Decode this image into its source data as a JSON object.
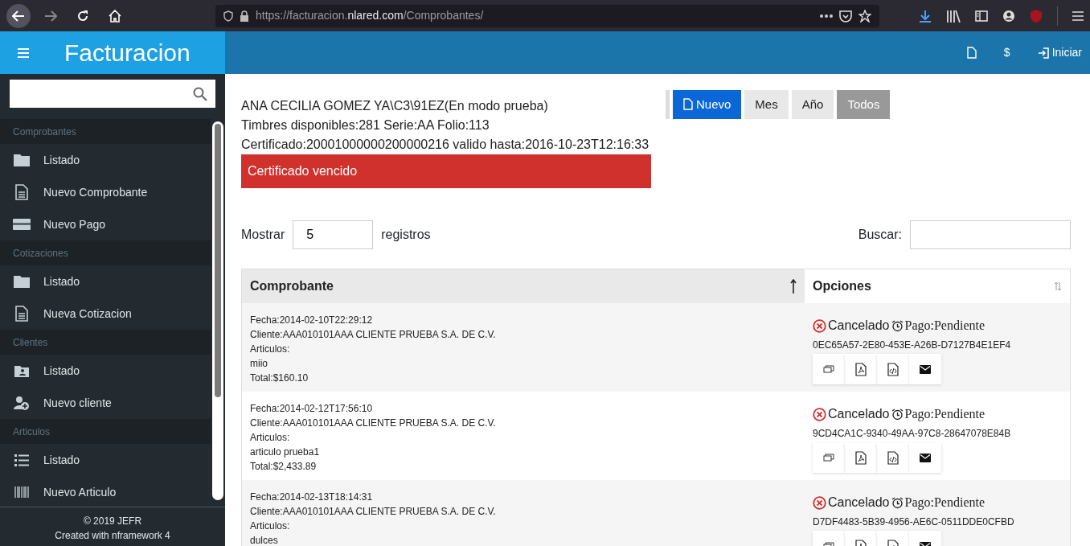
{
  "browser": {
    "url_prefix": "https://facturacion.",
    "url_domain": "nlared.com",
    "url_path": "/Comprobantes/"
  },
  "app_bar": {
    "title": "Facturacion",
    "actions": [
      {
        "kind": "file"
      },
      {
        "kind": "text",
        "label": "$"
      },
      {
        "kind": "login",
        "label": "Iniciar"
      }
    ]
  },
  "sidebar": {
    "sections": [
      {
        "title": "Comprobantes",
        "items": [
          {
            "kind": "folder",
            "label": "Listado"
          },
          {
            "kind": "document",
            "label": "Nuevo Comprobante"
          },
          {
            "kind": "card",
            "label": "Nuevo Pago"
          }
        ]
      },
      {
        "title": "Cotizaciones",
        "items": [
          {
            "kind": "folder",
            "label": "Listado"
          },
          {
            "kind": "document",
            "label": "Nueva Cotizacion"
          }
        ]
      },
      {
        "title": "Clientes",
        "items": [
          {
            "kind": "contact",
            "label": "Listado"
          },
          {
            "kind": "person-add",
            "label": "Nuevo cliente"
          }
        ]
      },
      {
        "title": "Articulos",
        "items": [
          {
            "kind": "list",
            "label": "Listado"
          },
          {
            "kind": "barcode",
            "label": "Nuevo Articulo"
          }
        ]
      }
    ],
    "footer": [
      "© 2019 JEFR",
      "Created with nframework 4"
    ]
  },
  "info": {
    "lines": [
      "ANA CECILIA GOMEZ YA\\C3\\91EZ(En modo prueba)",
      "Timbres disponibles:281 Serie:AA Folio:113",
      "Certificado:20001000000200000216 valido hasta:2016-10-23T12:16:33"
    ],
    "alert": "Certificado vencido"
  },
  "filter_buttons": [
    {
      "kind": "primary",
      "label": "Nuevo",
      "selected": false
    },
    {
      "kind": "filter",
      "label": "Mes",
      "selected": false
    },
    {
      "kind": "filter",
      "label": "Año",
      "selected": false
    },
    {
      "kind": "filter",
      "label": "Todos",
      "selected": true
    }
  ],
  "table_controls": {
    "show_label": "Mostrar",
    "page_size": "5",
    "records_label": "registros",
    "search_label": "Buscar:"
  },
  "table": {
    "columns": [
      {
        "label": "Comprobante",
        "sorted": true
      },
      {
        "label": "Opciones",
        "sorted": false
      }
    ],
    "rows": [
      {
        "lines": [
          "Fecha:2014-02-10T22:29:12",
          "Cliente:AAA010101AAA CLIENTE PRUEBA S.A. DE C.V.",
          "Articulos:",
          "miio",
          "Total:$160.10"
        ],
        "status": "Cancelado",
        "payment": "Pago:Pendiente",
        "uuid": "0EC65A57-2E80-453E-A26B-D7127B4E1EF4"
      },
      {
        "lines": [
          "Fecha:2014-02-12T17:56:10",
          "Cliente:AAA010101AAA CLIENTE PRUEBA S.A. DE C.V.",
          "Articulos:",
          "articulo prueba1",
          "Total:$2,433.89"
        ],
        "status": "Cancelado",
        "payment": "Pago:Pendiente",
        "uuid": "9CD4CA1C-9340-49AA-97C8-28647078E84B"
      },
      {
        "lines": [
          "Fecha:2014-02-13T18:14:31",
          "Cliente:AAA010101AAA CLIENTE PRUEBA S.A. DE C.V.",
          "Articulos:",
          "dulces"
        ],
        "status": "Cancelado",
        "payment": "Pago:Pendiente",
        "uuid": "D7DF4483-5B39-4956-AE6C-0511DDE0CFBD"
      }
    ]
  }
}
